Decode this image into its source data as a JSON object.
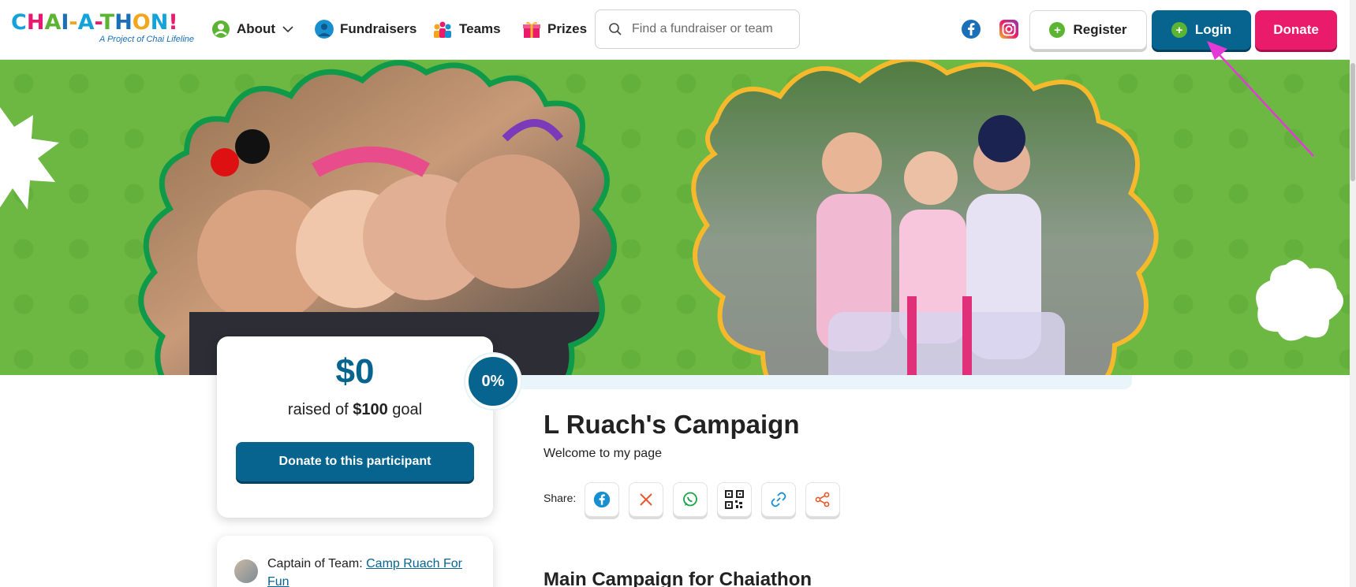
{
  "nav": {
    "logo_title": "CHAI-A-THON!",
    "logo_subtitle": "A Project of Chai Lifeline",
    "items": [
      {
        "label": "About",
        "icon": "chai-logo-icon",
        "dropdown": true
      },
      {
        "label": "Fundraisers",
        "icon": "person-avatar-icon"
      },
      {
        "label": "Teams",
        "icon": "team-icon"
      },
      {
        "label": "Prizes",
        "icon": "gift-icon"
      }
    ],
    "search_placeholder": "Find a fundraiser or team",
    "register_label": "Register",
    "login_label": "Login",
    "donate_label": "Donate"
  },
  "colors": {
    "brand_blue": "#07648f",
    "brand_pink": "#eb1b6b",
    "hero_green": "#6cb843",
    "frame_green": "#0f9a4a",
    "frame_yellow": "#f6b92b"
  },
  "campaign": {
    "amount_raised": "$0",
    "raised_prefix": "raised of",
    "goal": "$100",
    "goal_suffix": "goal",
    "percent": "0%",
    "donate_button": "Donate to this participant",
    "title": "L Ruach's Campaign",
    "welcome": "Welcome to my page",
    "share_label": "Share:",
    "share_buttons": [
      "facebook-icon",
      "x-icon",
      "whatsapp-icon",
      "qr-code-icon",
      "link-icon",
      "share-icon"
    ],
    "captain_prefix": "Captain of Team:",
    "team_name": "Camp Ruach For Fun",
    "main_section_title": "Main Campaign for Chaiathon"
  }
}
